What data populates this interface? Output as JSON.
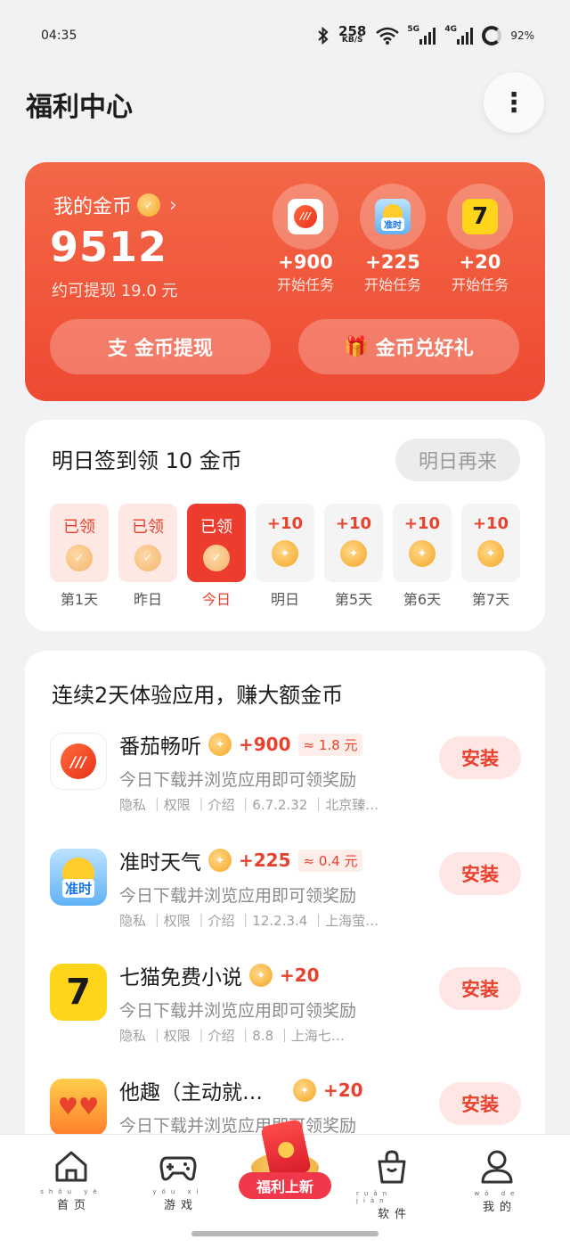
{
  "status_bar": {
    "time": "04:35",
    "net_speed_value": "258",
    "net_speed_unit": "KB/S",
    "signal_1_label": "5G",
    "signal_2_label": "4G",
    "battery": "92%"
  },
  "header": {
    "title": "福利中心",
    "more_icon": "⋮"
  },
  "coin_card": {
    "label": "我的金币",
    "chevron": "›",
    "value": "9512",
    "sub": "约可提现 19.0 元",
    "tasks": [
      {
        "amount": "+900",
        "label": "开始任务",
        "icon": "fanqie-app-icon"
      },
      {
        "amount": "+225",
        "label": "开始任务",
        "icon": "weather-app-icon"
      },
      {
        "amount": "+20",
        "label": "开始任务",
        "icon": "qimao-app-icon"
      }
    ],
    "withdraw_icon": "支",
    "withdraw_label": "金币提现",
    "gift_icon": "🎁",
    "gift_label": "金币兑好礼"
  },
  "sign_in": {
    "title": "明日签到领 10 金币",
    "button": "明日再来",
    "days": [
      {
        "reward": "已领",
        "name": "第1天",
        "state": "claimed"
      },
      {
        "reward": "已领",
        "name": "昨日",
        "state": "claimed"
      },
      {
        "reward": "已领",
        "name": "今日",
        "state": "today"
      },
      {
        "reward": "+10",
        "name": "明日",
        "state": "pending"
      },
      {
        "reward": "+10",
        "name": "第5天",
        "state": "pending"
      },
      {
        "reward": "+10",
        "name": "第6天",
        "state": "pending"
      },
      {
        "reward": "+10",
        "name": "第7天",
        "state": "pending"
      }
    ]
  },
  "task_list": {
    "title": "连续2天体验应用，赚大额金币",
    "apps": [
      {
        "name": "番茄畅听",
        "amount": "+900",
        "approx": "≈ 1.8 元",
        "desc": "今日下载并浏览应用即可领奖励",
        "meta": "隐私 ｜权限 ｜介绍 ｜6.7.2.32 ｜北京臻…",
        "button": "安装",
        "icon_text": "///"
      },
      {
        "name": "准时天气",
        "amount": "+225",
        "approx": "≈ 0.4 元",
        "desc": "今日下载并浏览应用即可领奖励",
        "meta": "隐私 ｜权限 ｜介绍 ｜12.2.3.4 ｜上海萤…",
        "button": "安装",
        "icon_text": "准时"
      },
      {
        "name": "七猫免费小说",
        "amount": "+20",
        "approx": "",
        "desc": "今日下载并浏览应用即可领奖励",
        "meta": "隐私 ｜权限 ｜介绍 ｜8.8 ｜上海七…",
        "button": "安装",
        "icon_text": "7"
      },
      {
        "name": "他趣（主动就…",
        "amount": "+20",
        "approx": "",
        "desc": "今日下载并浏览应用即可领奖励",
        "meta": "",
        "button": "安装",
        "icon_text": ""
      }
    ]
  },
  "bottom_nav": {
    "items": [
      {
        "label": "首页",
        "pinyin": "shǒu yè",
        "icon": "home-icon"
      },
      {
        "label": "游戏",
        "pinyin": "yóu xì",
        "icon": "gamepad-icon"
      },
      {
        "label": "软件",
        "pinyin": "ruǎn jiàn",
        "icon": "bag-icon"
      },
      {
        "label": "我的",
        "pinyin": "wǒ de",
        "icon": "person-icon"
      }
    ],
    "center_label": "福利上新"
  },
  "colors": {
    "accent": "#ee4a32",
    "coin": "#f5a623",
    "background": "#f1f2f4"
  }
}
